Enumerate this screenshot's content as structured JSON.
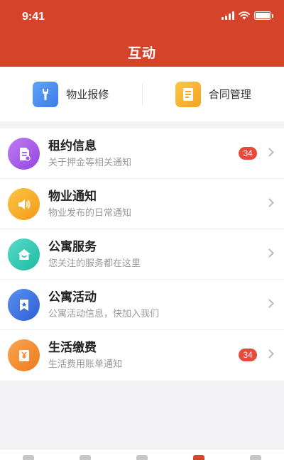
{
  "status_bar": {
    "time": "9:41"
  },
  "header": {
    "title": "互动"
  },
  "quick_actions": [
    {
      "label": "物业报修",
      "icon": "wrench-icon",
      "color": "#3d7be8"
    },
    {
      "label": "合同管理",
      "icon": "contract-icon",
      "color": "#f4a41e"
    }
  ],
  "list": [
    {
      "title": "租约信息",
      "subtitle": "关于押金等相关通知",
      "badge": "34",
      "icon": "document-icon",
      "color": "#a25be6"
    },
    {
      "title": "物业通知",
      "subtitle": "物业发布的日常通知",
      "badge": "",
      "icon": "speaker-icon",
      "color": "#f6a71f"
    },
    {
      "title": "公寓服务",
      "subtitle": "您关注的服务都在这里",
      "badge": "",
      "icon": "home-icon",
      "color": "#2fcab5"
    },
    {
      "title": "公寓活动",
      "subtitle": "公寓活动信息，快加入我们",
      "badge": "",
      "icon": "bookmark-icon",
      "color": "#3c6fe0"
    },
    {
      "title": "生活缴费",
      "subtitle": "生活费用账单通知",
      "badge": "34",
      "icon": "bill-icon",
      "color": "#f58a2a"
    }
  ],
  "colors": {
    "brand": "#d6432b",
    "badge": "#e64a3b"
  }
}
